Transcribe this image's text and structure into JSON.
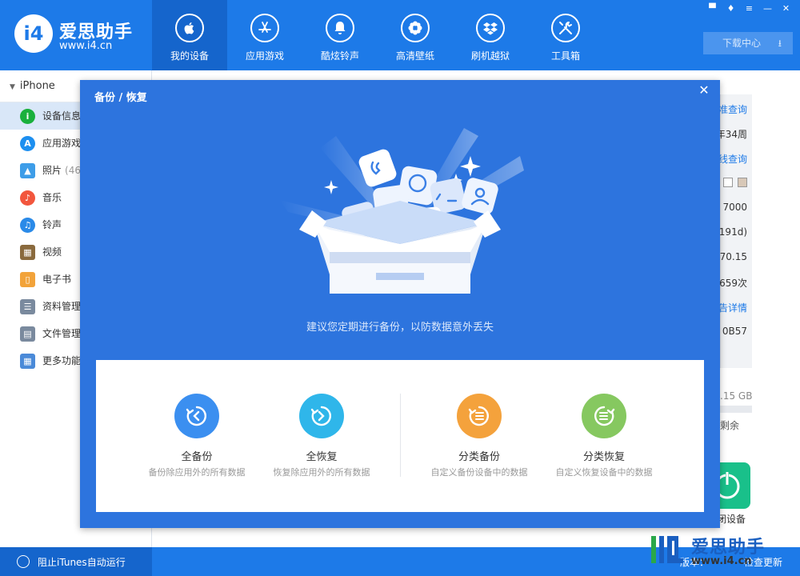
{
  "app": {
    "logo_mark": "i4",
    "logo_title": "爱思助手",
    "logo_url": "www.i4.cn"
  },
  "nav": [
    {
      "id": "my-device",
      "label": "我的设备",
      "icon": "apple-icon",
      "active": true
    },
    {
      "id": "apps-games",
      "label": "应用游戏",
      "icon": "app-store-icon",
      "active": false
    },
    {
      "id": "ringtones",
      "label": "酷炫铃声",
      "icon": "bell-icon",
      "active": false
    },
    {
      "id": "wallpapers",
      "label": "高清壁纸",
      "icon": "flower-icon",
      "active": false
    },
    {
      "id": "jailbreak",
      "label": "刷机越狱",
      "icon": "dropbox-icon",
      "active": false
    },
    {
      "id": "toolbox",
      "label": "工具箱",
      "icon": "tools-icon",
      "active": false
    }
  ],
  "window_controls": [
    "message-icon",
    "shirt-icon",
    "menu-icon",
    "minimize-icon",
    "close-icon"
  ],
  "download_center": "下载中心",
  "sidebar": {
    "device_name": "iPhone",
    "items": [
      {
        "label": "设备信息",
        "icon": "info-icon",
        "color": "#19b03c",
        "active": true
      },
      {
        "label": "应用游戏",
        "icon": "app-store-icon",
        "color": "#1d8ff0",
        "active": false
      },
      {
        "label": "照片",
        "count": "(46",
        "icon": "photo-icon",
        "color": "#3d9de8",
        "active": false
      },
      {
        "label": "音乐",
        "icon": "music-icon",
        "color": "#f2563d",
        "active": false
      },
      {
        "label": "铃声",
        "icon": "bell-icon",
        "color": "#2a8ae8",
        "active": false
      },
      {
        "label": "视频",
        "icon": "film-icon",
        "color": "#8a6a3d",
        "active": false
      },
      {
        "label": "电子书",
        "icon": "book-icon",
        "color": "#f2a33a",
        "active": false
      },
      {
        "label": "资料管理",
        "icon": "contacts-icon",
        "color": "#7a8a9e",
        "active": false
      },
      {
        "label": "文件管理",
        "icon": "file-icon",
        "color": "#7a8a9e",
        "active": false
      },
      {
        "label": "更多功能",
        "icon": "grid-icon",
        "color": "#4a8ad8",
        "active": false
      }
    ]
  },
  "device_info_fragments": [
    {
      "text": "准查询",
      "link": true
    },
    {
      "text": "年34周",
      "link": false
    },
    {
      "text": "线查询",
      "link": true
    },
    {
      "text": "",
      "link": false
    },
    {
      "text": "7000",
      "link": false
    },
    {
      "text": "191d)",
      "link": false
    },
    {
      "text": "70.15",
      "link": false
    },
    {
      "text": "659次",
      "link": false
    },
    {
      "text": "告详情",
      "link": true
    },
    {
      "text": "0B57",
      "link": false
    }
  ],
  "storage": {
    "total_fragment": ".15 GB",
    "remaining_label": "剩余"
  },
  "power_button_label": "闭设备",
  "bottom": {
    "itunes_label": "阻止iTunes自动运行",
    "version_fragment": "版本：",
    "update_label": "检查更新"
  },
  "watermark": {
    "title": "爱思助手",
    "url": "www.i4.cn"
  },
  "modal": {
    "title": "备份 / 恢复",
    "close": "✕",
    "subtitle": "建议您定期进行备份，以防数据意外丢失",
    "options": [
      {
        "id": "full-backup",
        "title": "全备份",
        "desc": "备份除应用外的所有数据",
        "color": "#3b8ff0",
        "icon": "backup-icon"
      },
      {
        "id": "full-restore",
        "title": "全恢复",
        "desc": "恢复除应用外的所有数据",
        "color": "#2fb6ea",
        "icon": "restore-icon"
      },
      {
        "id": "category-backup",
        "title": "分类备份",
        "desc": "自定义备份设备中的数据",
        "color": "#f4a23c",
        "icon": "category-backup-icon"
      },
      {
        "id": "category-restore",
        "title": "分类恢复",
        "desc": "自定义恢复设备中的数据",
        "color": "#86c860",
        "icon": "category-restore-icon"
      }
    ]
  }
}
